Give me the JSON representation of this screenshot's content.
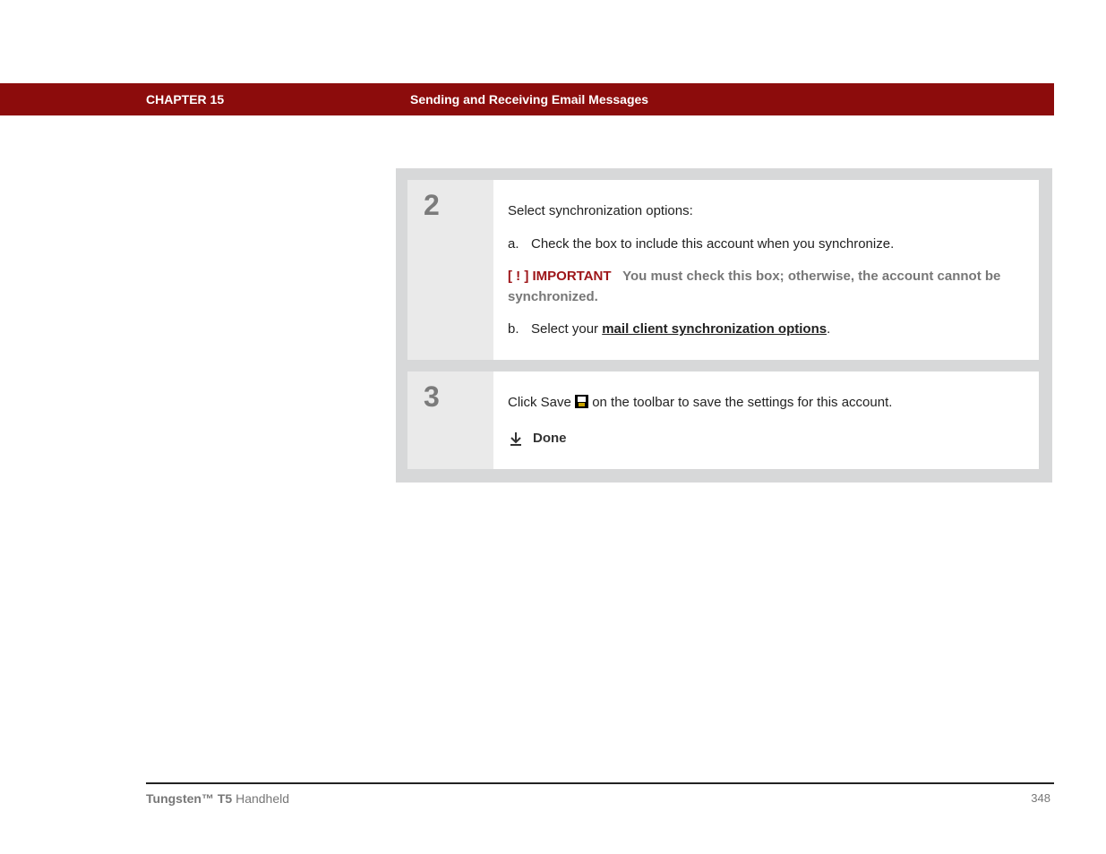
{
  "header": {
    "chapter_label": "CHAPTER 15",
    "chapter_title": "Sending and Receiving Email Messages"
  },
  "steps": [
    {
      "number": "2",
      "intro": "Select synchronization options:",
      "item_a_letter": "a.",
      "item_a_text": "Check the box to include this account when you synchronize.",
      "important_bracket_open": "[ ",
      "important_bang": "!",
      "important_bracket_close": " ]",
      "important_label": " IMPORTANT",
      "important_text": "You must check this box; otherwise, the account cannot be synchronized.",
      "item_b_letter": "b.",
      "item_b_prefix": "Select your ",
      "item_b_link": "mail client synchronization options",
      "item_b_suffix": "."
    },
    {
      "number": "3",
      "text_before_icon": "Click Save ",
      "text_after_icon": " on the toolbar to save the settings for this account.",
      "done_label": "Done"
    }
  ],
  "footer": {
    "product_bold": "Tungsten™ T5",
    "product_rest": " Handheld",
    "page_number": "348"
  }
}
